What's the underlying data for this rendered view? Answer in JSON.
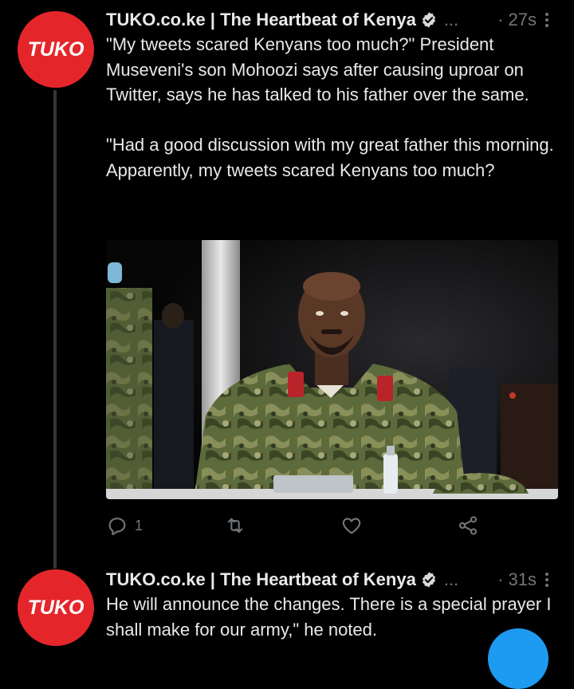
{
  "tweets": [
    {
      "avatar_text": "TUKO",
      "author": "TUKO.co.ke | The Heartbeat of Kenya",
      "truncation": "...",
      "time": "· 27s",
      "body": [
        "\"My tweets scared Kenyans too much?\" President Museveni's son Mohoozi says after causing uproar on Twitter, says he has talked to his father over the same.",
        "\"Had a good discussion with my great father this morning. Apparently, my tweets scared Kenyans too much?"
      ],
      "reply_count": "1",
      "media_icon": "photo",
      "colors": {
        "avatar": "#e4262b",
        "verified": "#d9d9d9"
      }
    },
    {
      "avatar_text": "TUKO",
      "author": "TUKO.co.ke | The Heartbeat of Kenya",
      "truncation": "...",
      "time": "· 31s",
      "body": [
        "He will announce the changes. There is a special prayer I shall make for our army,\" he noted."
      ]
    }
  ],
  "icons": {
    "reply": "reply-icon",
    "retweet": "retweet-icon",
    "like": "heart-icon",
    "share": "share-icon",
    "more": "more-icon",
    "verified": "verified-badge-icon"
  },
  "colors": {
    "background": "#000000",
    "text": "#e7e9ea",
    "muted": "#71767b",
    "accent": "#1d9bf0"
  }
}
